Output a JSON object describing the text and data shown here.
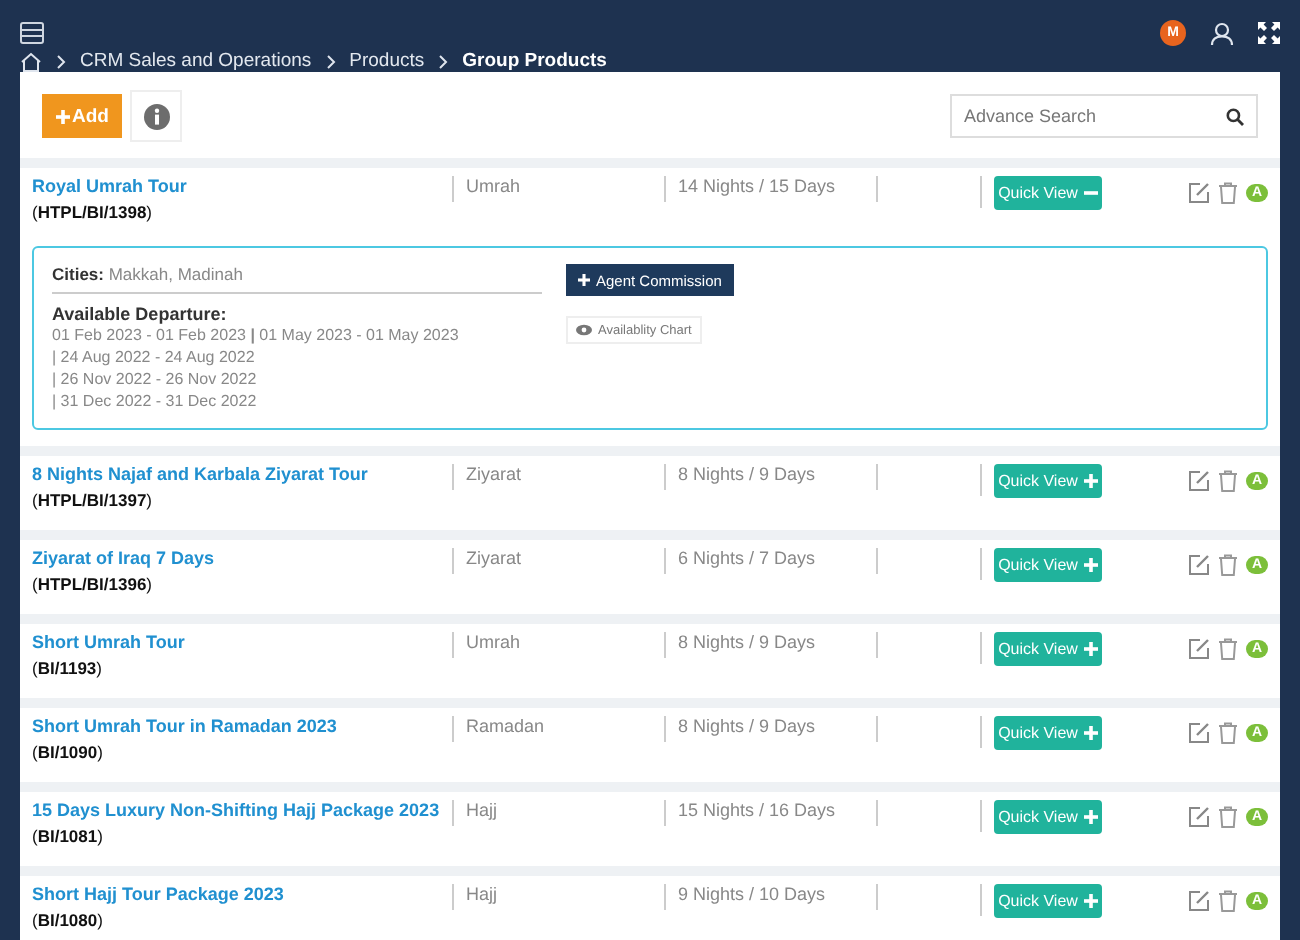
{
  "header": {
    "avatar_initial": "M"
  },
  "breadcrumb": [
    {
      "label": "CRM Sales and Operations",
      "current": false
    },
    {
      "label": "Products",
      "current": false
    },
    {
      "label": "Group Products",
      "current": true
    }
  ],
  "toolbar": {
    "add_label": "Add",
    "search": {
      "placeholder": "Advance Search"
    }
  },
  "rows": [
    {
      "name": "Royal Umrah Tour",
      "code": "(**HTPL/BI/1398**)",
      "category": "Umrah",
      "duration": "14 Nights / 15 Days",
      "quick_view": "Quick View",
      "expanded": true,
      "status": "A",
      "details": {
        "cities_label": "Cities:",
        "cities": "Makkah, Madinah",
        "departure_label": "Available Departure:",
        "departures": [
          "01 Feb 2023 - 01 Feb 2023 **|** 01 May 2023 - 01 May 2023",
          "| 24 Aug 2022 - 24 Aug 2022",
          "| 26 Nov 2022 - 26 Nov 2022",
          "| 31 Dec 2022 - 31 Dec 2022"
        ],
        "commission_label": "Agent Commission",
        "chart_label": "Availablity Chart"
      }
    },
    {
      "name": "8 Nights Najaf and Karbala Ziyarat Tour",
      "code": "(**HTPL/BI/1397**)",
      "category": "Ziyarat",
      "duration": "8 Nights / 9 Days",
      "quick_view": "Quick View",
      "expanded": false,
      "status": "A"
    },
    {
      "name": "Ziyarat of Iraq 7 Days",
      "code": "(**HTPL/BI/1396**)",
      "category": "Ziyarat",
      "duration": "6 Nights / 7 Days",
      "quick_view": "Quick View",
      "expanded": false,
      "status": "A"
    },
    {
      "name": "Short Umrah Tour",
      "code": "(**BI/1193**)",
      "category": "Umrah",
      "duration": "8 Nights / 9 Days",
      "quick_view": "Quick View",
      "expanded": false,
      "status": "A"
    },
    {
      "name": "Short Umrah Tour in Ramadan 2023",
      "code": "(**BI/1090**)",
      "category": "Ramadan",
      "duration": "8 Nights / 9 Days",
      "quick_view": "Quick View",
      "expanded": false,
      "status": "A"
    },
    {
      "name": "15 Days Luxury Non-Shifting Hajj Package 2023",
      "code": "(**BI/1081**)",
      "category": "Hajj",
      "duration": "15 Nights / 16 Days",
      "quick_view": "Quick View",
      "expanded": false,
      "status": "A"
    },
    {
      "name": "Short Hajj Tour Package 2023",
      "code": "(**BI/1080**)",
      "category": "Hajj",
      "duration": "9 Nights / 10 Days",
      "quick_view": "Quick View",
      "expanded": false,
      "status": "A"
    }
  ]
}
